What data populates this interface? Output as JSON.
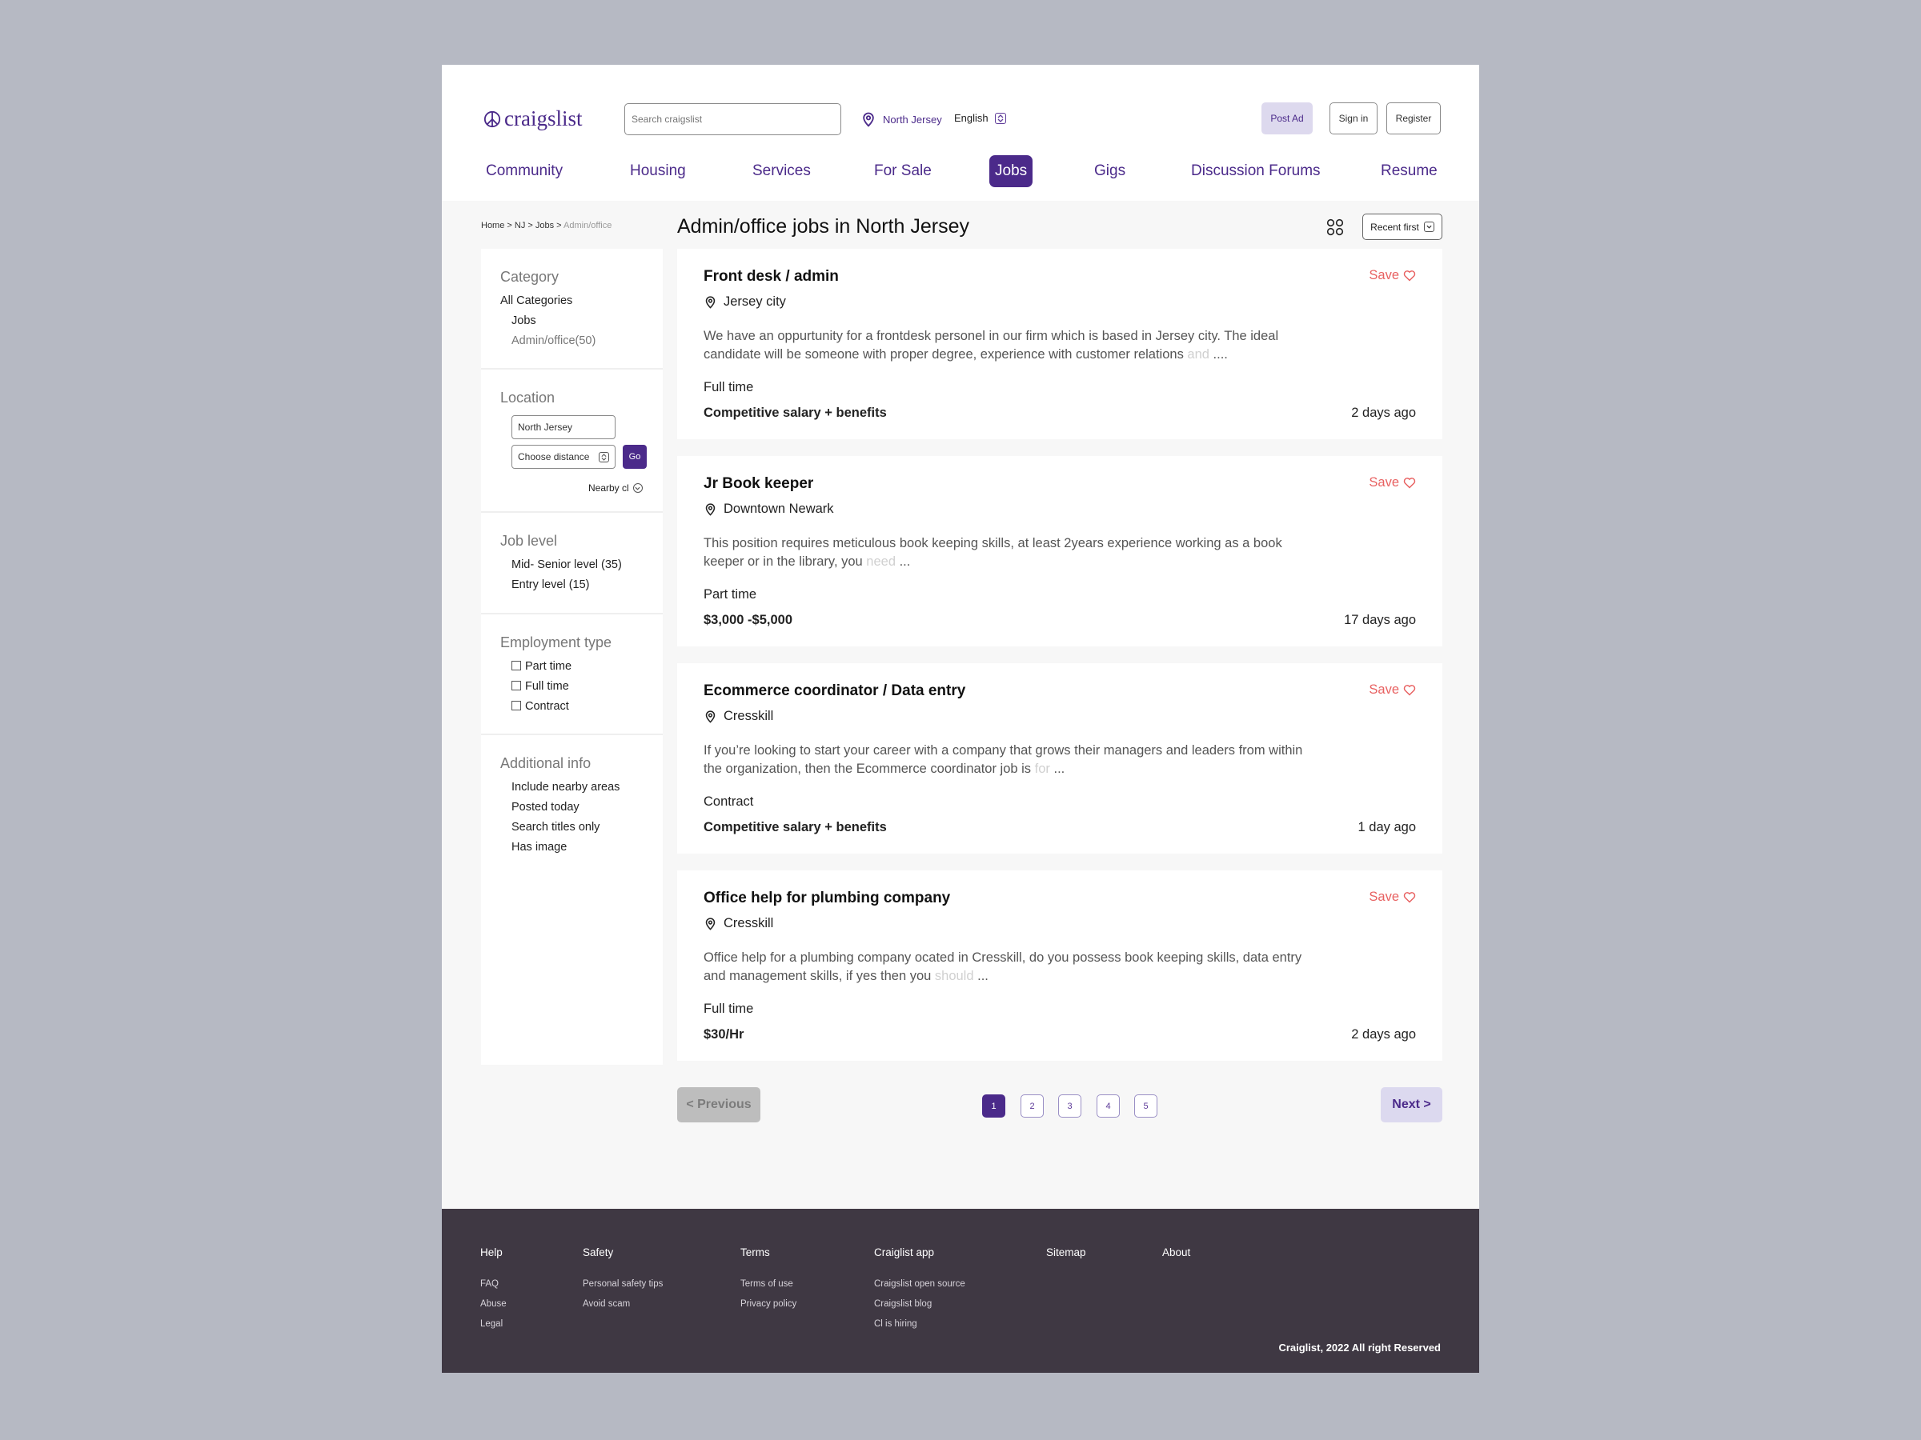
{
  "header": {
    "logo_text": "craigslist",
    "search_placeholder": "Search craigslist",
    "location": "North Jersey",
    "language": "English",
    "post_ad": "Post Ad",
    "sign_in": "Sign in",
    "register": "Register"
  },
  "nav": {
    "items": [
      "Community",
      "Housing",
      "Services",
      "For Sale",
      "Jobs",
      "Gigs",
      "Discussion Forums",
      "Resume"
    ],
    "active": "Jobs"
  },
  "breadcrumb": {
    "path": "Home > NJ > Jobs > ",
    "current": "Admin/office"
  },
  "page_title": "Admin/office jobs in North Jersey",
  "sort_label": "Recent first",
  "sidebar": {
    "category": {
      "title": "Category",
      "all": "All Categories",
      "jobs": "Jobs",
      "sub": "Admin/office(50)"
    },
    "location": {
      "title": "Location",
      "value": "North Jersey",
      "distance_placeholder": "Choose distance",
      "go": "Go",
      "nearby": "Nearby cl"
    },
    "job_level": {
      "title": "Job level",
      "items": [
        "Mid- Senior level (35)",
        "Entry level (15)"
      ]
    },
    "employment_type": {
      "title": "Employment type",
      "items": [
        "Part time",
        "Full time",
        "Contract"
      ]
    },
    "additional_info": {
      "title": "Additional info",
      "items": [
        "Include nearby areas",
        "Posted today",
        "Search titles only",
        "Has image"
      ]
    }
  },
  "jobs": [
    {
      "title": "Front desk / admin",
      "location": "Jersey city",
      "desc": "We have an oppurtunity for a frontdesk personel in our firm which is based in Jersey city. The ideal candidate will be someone with proper degree, experience with customer relations ",
      "desc_fade": "and",
      "desc_end": " ....",
      "type": "Full time",
      "pay": "Competitive salary + benefits",
      "age": "2 days ago",
      "save": "Save"
    },
    {
      "title": "Jr Book keeper",
      "location": "Downtown Newark",
      "desc": "This position requires meticulous book keeping skills, at least 2years experience working as a book keeper or in the library, you ",
      "desc_fade": "need",
      "desc_end": " ...",
      "type": "Part time",
      "pay": "$3,000 -$5,000",
      "age": "17 days ago",
      "save": "Save"
    },
    {
      "title": "Ecommerce coordinator / Data entry",
      "location": "Cresskill",
      "desc": "If you’re looking to start your career with a company that grows their managers and leaders from within the organization, then the Ecommerce coordinator job is ",
      "desc_fade": "for",
      "desc_end": " ...",
      "type": "Contract",
      "pay": "Competitive salary + benefits",
      "age": "1 day ago",
      "save": "Save"
    },
    {
      "title": "Office help for plumbing company",
      "location": "Cresskill",
      "desc": "Office help for a plumbing company ocated in Cresskill, do you possess book keeping skills, data entry and management skills, if yes then you ",
      "desc_fade": "should",
      "desc_end": " ...",
      "type": "Full time",
      "pay": "$30/Hr",
      "age": "2 days ago",
      "save": "Save"
    }
  ],
  "pagination": {
    "previous": "< Previous",
    "next": "Next >",
    "pages": [
      "1",
      "2",
      "3",
      "4",
      "5"
    ],
    "current": "1"
  },
  "footer": {
    "columns": [
      {
        "heading": "Help",
        "links": [
          "FAQ",
          "Abuse",
          "Legal"
        ]
      },
      {
        "heading": "Safety",
        "links": [
          "Personal safety tips",
          "Avoid scam"
        ]
      },
      {
        "heading": "Terms",
        "links": [
          "Terms of use",
          "Privacy policy"
        ]
      },
      {
        "heading": "Craiglist app",
        "links": [
          "Craigslist open source",
          "Craigslist blog",
          "Cl is hiring"
        ]
      },
      {
        "heading": "Sitemap",
        "links": []
      },
      {
        "heading": "About",
        "links": []
      }
    ],
    "copyright": "Craiglist, 2022 All right Reserved"
  },
  "colors": {
    "brand": "#4b2a8a",
    "save": "#e86161",
    "footer_bg": "#3f3843"
  }
}
